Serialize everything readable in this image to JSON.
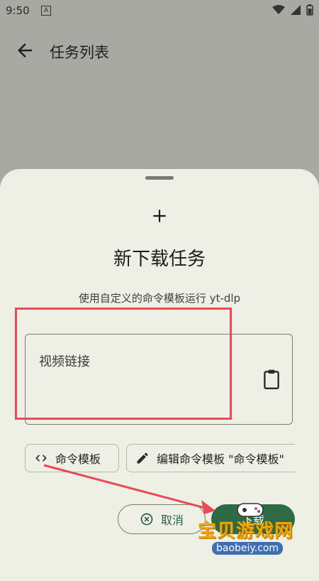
{
  "status_bar": {
    "time": "9:50",
    "notif_letter": "A"
  },
  "app_bar": {
    "title": "任务列表"
  },
  "sheet": {
    "title": "新下载任务",
    "subtitle": "使用自定义的命令模板运行 yt-dlp",
    "url_field": {
      "placeholder": "视频链接"
    },
    "chips": {
      "template_label": "命令模板",
      "edit_template_label": "编辑命令模板 \"命令模板\""
    },
    "buttons": {
      "cancel_label": "取消",
      "confirm_label": "下载"
    }
  },
  "watermark": {
    "text": "宝贝游戏网",
    "url": "baobeiy.com"
  },
  "colors": {
    "accent": "#2e6a45",
    "highlight": "#e84a56",
    "sheet_bg": "#eef0e6",
    "scrim": "#a9a9a3"
  }
}
